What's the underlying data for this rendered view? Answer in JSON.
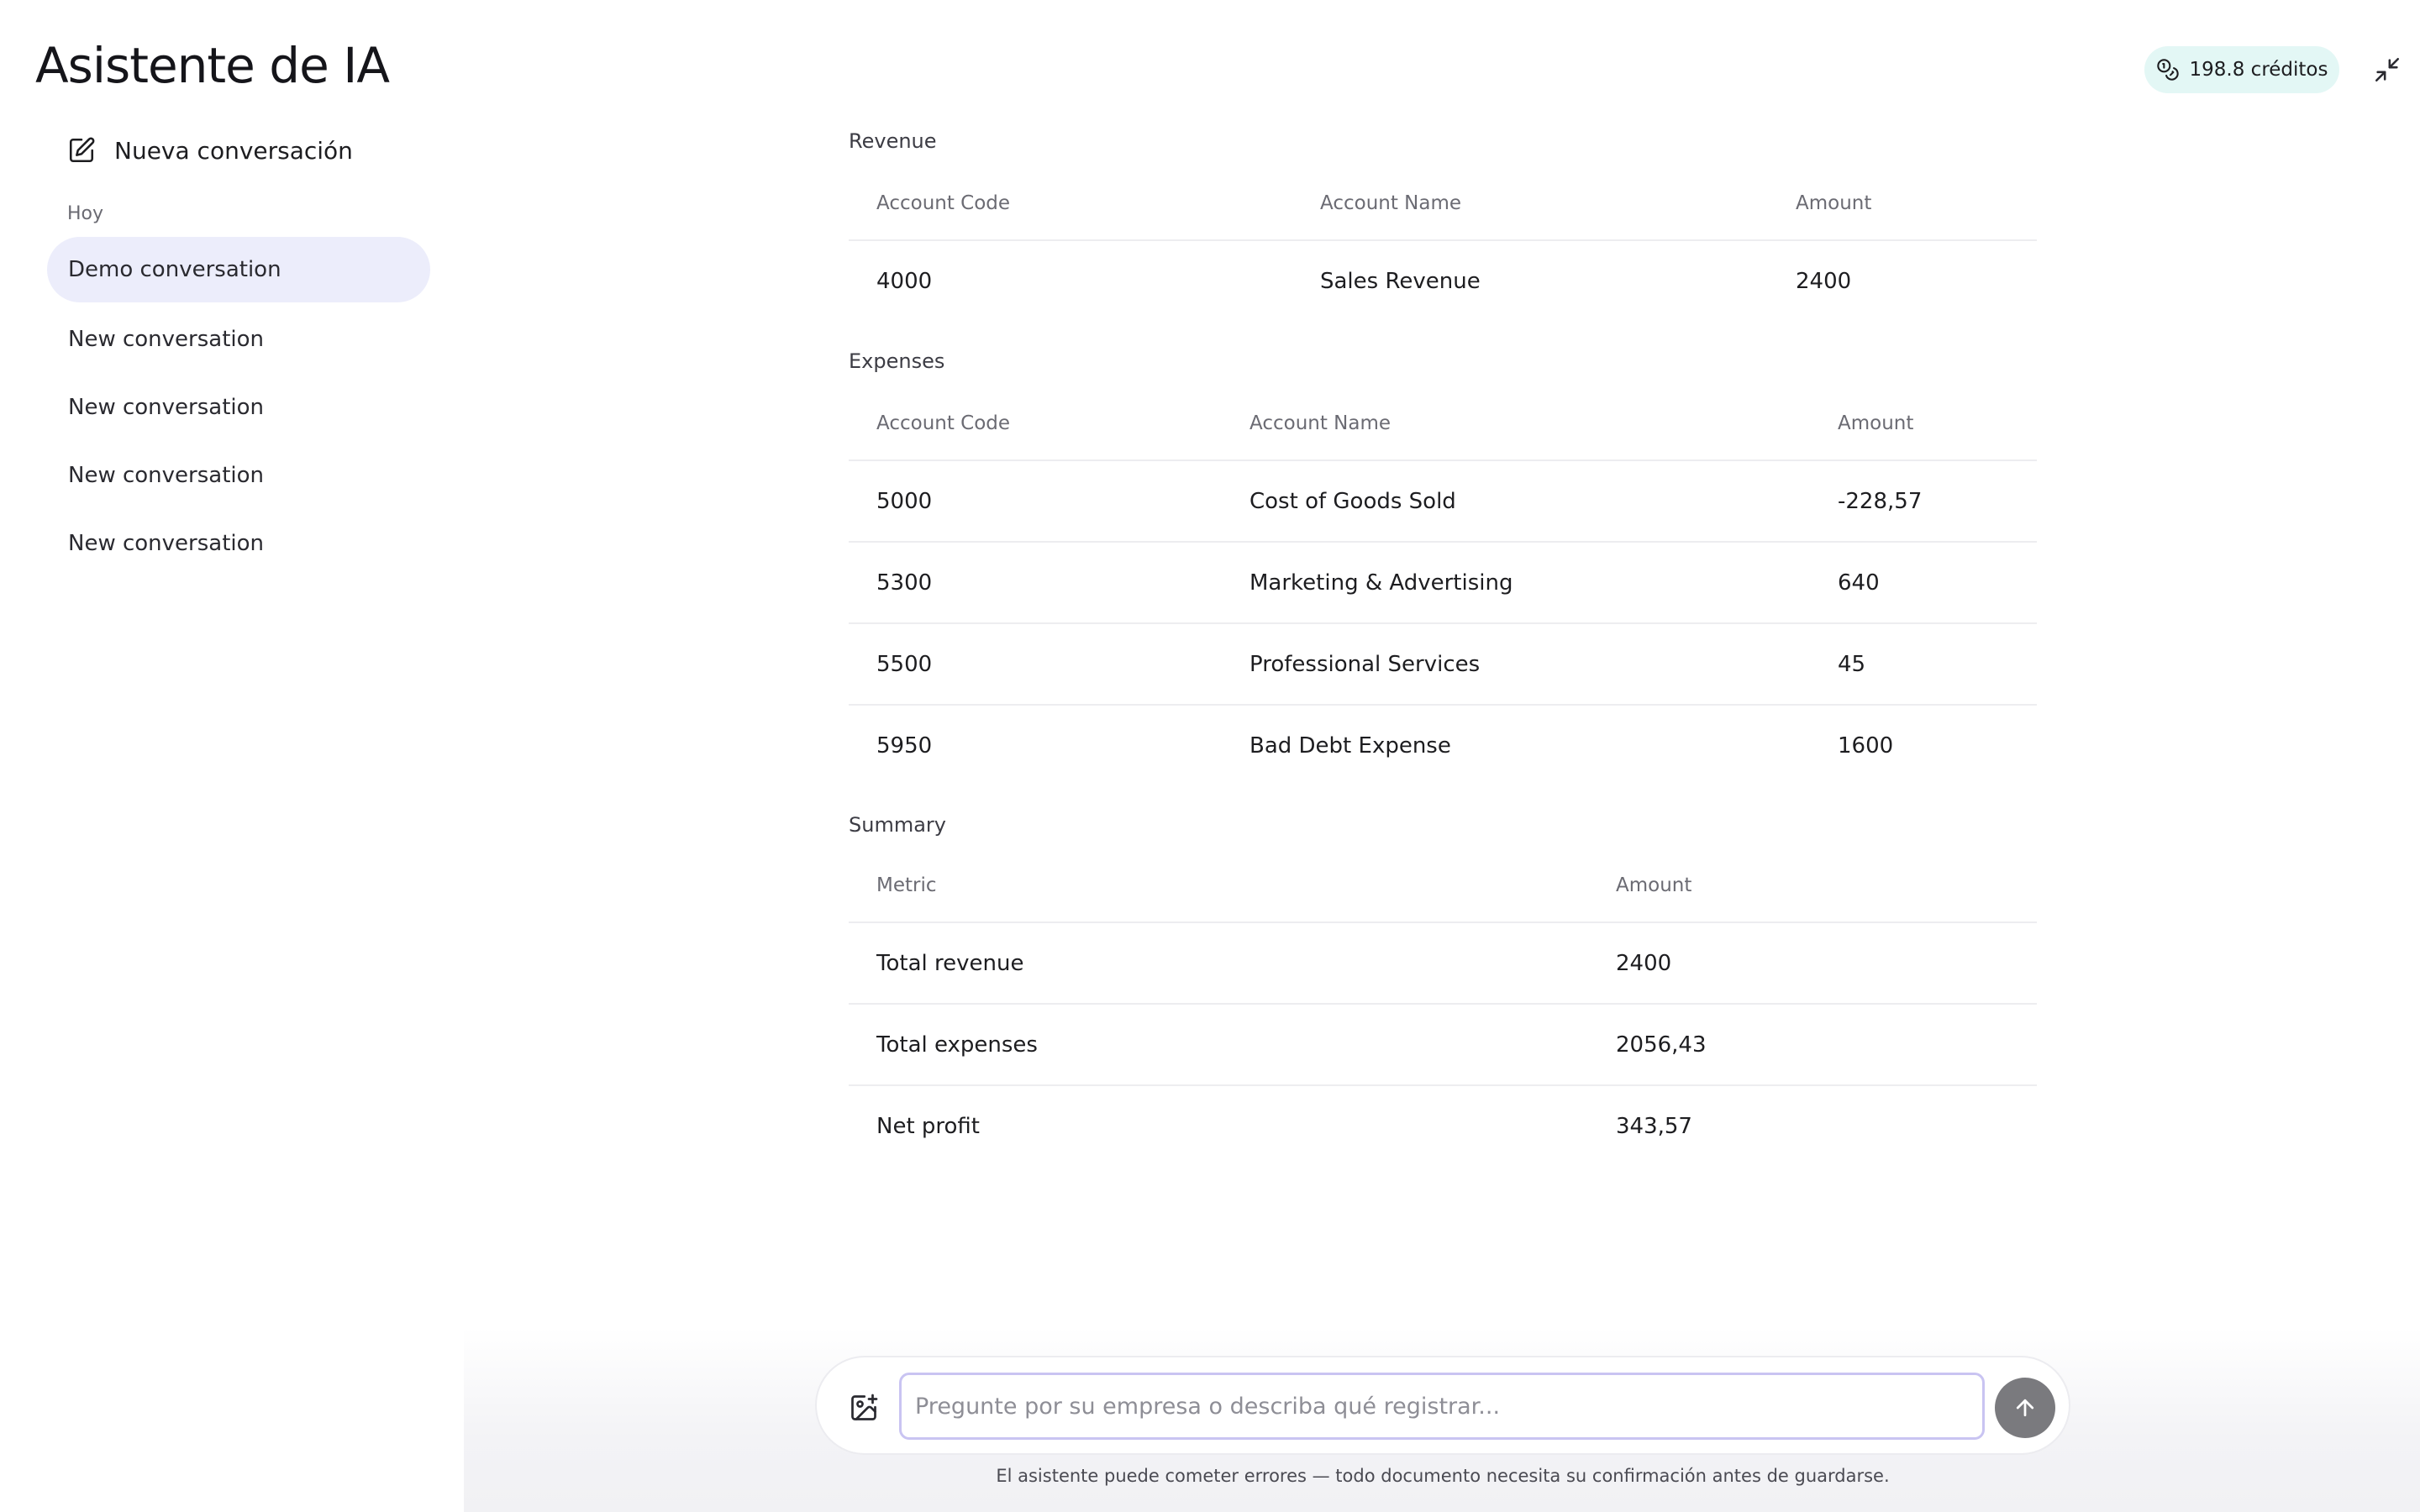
{
  "app": {
    "title": "Asistente de IA"
  },
  "header": {
    "credits": "198.8 créditos"
  },
  "sidebar": {
    "new_conversation": "Nueva conversación",
    "section_today": "Hoy",
    "items": [
      {
        "label": "Demo conversation",
        "active": true
      },
      {
        "label": "New conversation",
        "active": false
      },
      {
        "label": "New conversation",
        "active": false
      },
      {
        "label": "New conversation",
        "active": false
      },
      {
        "label": "New conversation",
        "active": false
      }
    ]
  },
  "report": {
    "revenue": {
      "caption": "Revenue",
      "headers": [
        "Account Code",
        "Account Name",
        "Amount"
      ],
      "rows": [
        [
          "4000",
          "Sales Revenue",
          "2400"
        ]
      ]
    },
    "expenses": {
      "caption": "Expenses",
      "headers": [
        "Account Code",
        "Account Name",
        "Amount"
      ],
      "rows": [
        [
          "5000",
          "Cost of Goods Sold",
          "-228,57"
        ],
        [
          "5300",
          "Marketing & Advertising",
          "640"
        ],
        [
          "5500",
          "Professional Services",
          "45"
        ],
        [
          "5950",
          "Bad Debt Expense",
          "1600"
        ]
      ]
    },
    "summary": {
      "caption": "Summary",
      "headers": [
        "Metric",
        "Amount"
      ],
      "rows": [
        [
          "Total revenue",
          "2400"
        ],
        [
          "Total expenses",
          "2056,43"
        ],
        [
          "Net profit",
          "343,57"
        ]
      ]
    }
  },
  "composer": {
    "placeholder": "Pregunte por su empresa o describa qué registrar...",
    "value": ""
  },
  "footer": {
    "disclaimer": "El asistente puede cometer errores — todo documento necesita su confirmación antes de guardarse."
  },
  "colors": {
    "credits_bg": "#e3f7f5",
    "active_item_bg": "#ecedfb",
    "input_border": "#c9c4f2",
    "send_button": "#7a7a7e"
  }
}
